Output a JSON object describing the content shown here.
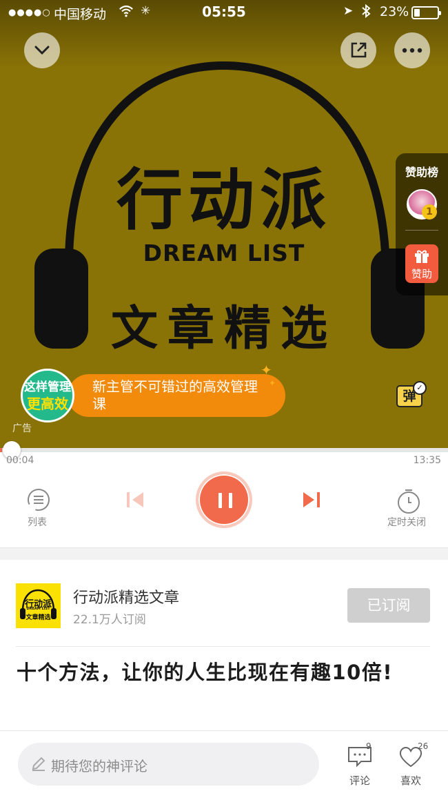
{
  "status_bar": {
    "signal": "●●●●○",
    "carrier": "中国移动",
    "time": "05:55",
    "battery": "23%"
  },
  "cover": {
    "title_cn": "行动派",
    "title_en": "DREAM LIST",
    "subtitle_cn": "文章精选"
  },
  "sponsor": {
    "title": "赞助榜",
    "rank": "1",
    "gift_label": "赞助"
  },
  "ad": {
    "badge_line1": "这样管理",
    "badge_line2": "更高效",
    "text": "新主管不可错过的高效管理课",
    "tag": "广告"
  },
  "danmu": {
    "label": "弹"
  },
  "player": {
    "current_time": "00:04",
    "total_time": "13:35",
    "progress": 0.005,
    "list_label": "列表",
    "timer_label": "定时关闭"
  },
  "album": {
    "cover_title": "行动派",
    "cover_en": "DREAM LIST",
    "cover_sub": "文章精选",
    "name": "行动派精选文章",
    "subscribers": "22.1万人订阅",
    "subscribe_label": "已订阅"
  },
  "article": {
    "title": "十个方法，让你的人生比现在有趣10倍!"
  },
  "bottom": {
    "comment_placeholder": "期待您的神评论",
    "comment_label": "评论",
    "comment_count": "9",
    "like_label": "喜欢",
    "like_count": "26"
  },
  "colors": {
    "accent": "#f26a4c",
    "cover_bg": "#8a7306",
    "ad_orange": "#f28a0c",
    "album_yellow": "#fbe102"
  }
}
